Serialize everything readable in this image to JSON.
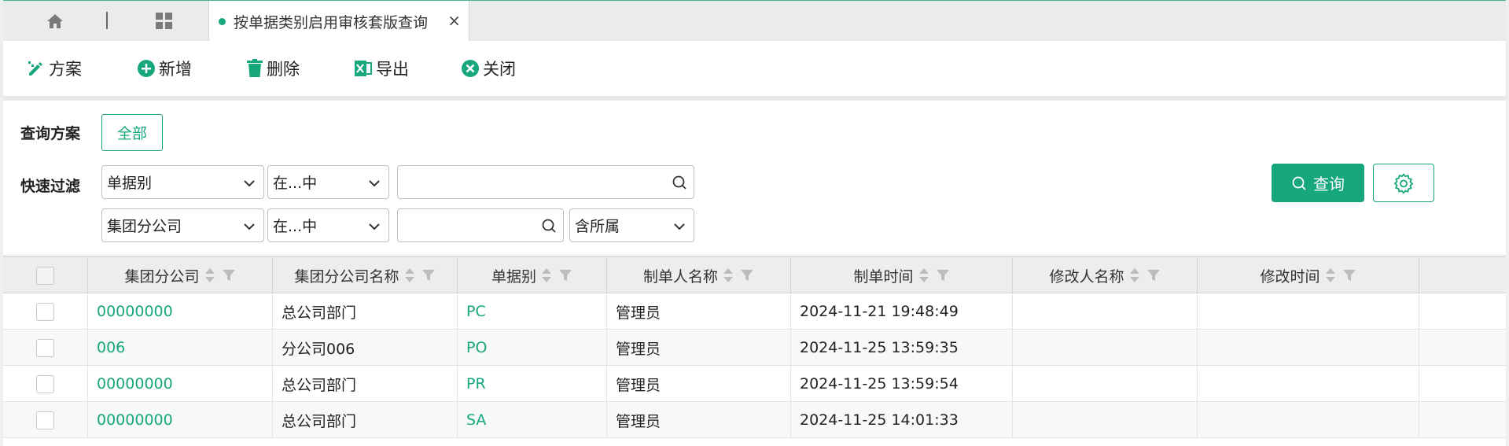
{
  "tabs": {
    "active_label": "按单据类别启用审核套版查询",
    "close_glyph": "×"
  },
  "toolbar": {
    "scheme": "方案",
    "add": "新增",
    "delete": "删除",
    "export": "导出",
    "close": "关闭"
  },
  "filter": {
    "scheme_label": "查询方案",
    "scheme_all": "全部",
    "quick_label": "快速过滤",
    "row1": {
      "field": "单据别",
      "op": "在...中",
      "value": ""
    },
    "row2": {
      "field": "集团分公司",
      "op": "在...中",
      "value": "",
      "scope": "含所属"
    },
    "query_button": "查询"
  },
  "table": {
    "columns": [
      "集团分公司",
      "集团分公司名称",
      "单据别",
      "制单人名称",
      "制单时间",
      "修改人名称",
      "修改时间"
    ],
    "rows": [
      {
        "company": "00000000",
        "company_name": "总公司部门",
        "doc_type": "PC",
        "creator": "管理员",
        "created": "2024-11-21 19:48:49",
        "modifier": "",
        "modified": ""
      },
      {
        "company": "006",
        "company_name": "分公司006",
        "doc_type": "PO",
        "creator": "管理员",
        "created": "2024-11-25 13:59:35",
        "modifier": "",
        "modified": ""
      },
      {
        "company": "00000000",
        "company_name": "总公司部门",
        "doc_type": "PR",
        "creator": "管理员",
        "created": "2024-11-25 13:59:54",
        "modifier": "",
        "modified": ""
      },
      {
        "company": "00000000",
        "company_name": "总公司部门",
        "doc_type": "SA",
        "creator": "管理员",
        "created": "2024-11-25 14:01:33",
        "modifier": "",
        "modified": ""
      }
    ]
  },
  "colors": {
    "accent": "#17a77d",
    "danger_icon": "#17a77d"
  },
  "icons": [
    "home-icon",
    "apps-grid-icon",
    "scheme-edit-icon",
    "add-circle-icon",
    "trash-icon",
    "excel-export-icon",
    "close-circle-icon",
    "search-icon",
    "chevron-down-icon",
    "gear-icon",
    "sort-icon",
    "filter-icon"
  ]
}
